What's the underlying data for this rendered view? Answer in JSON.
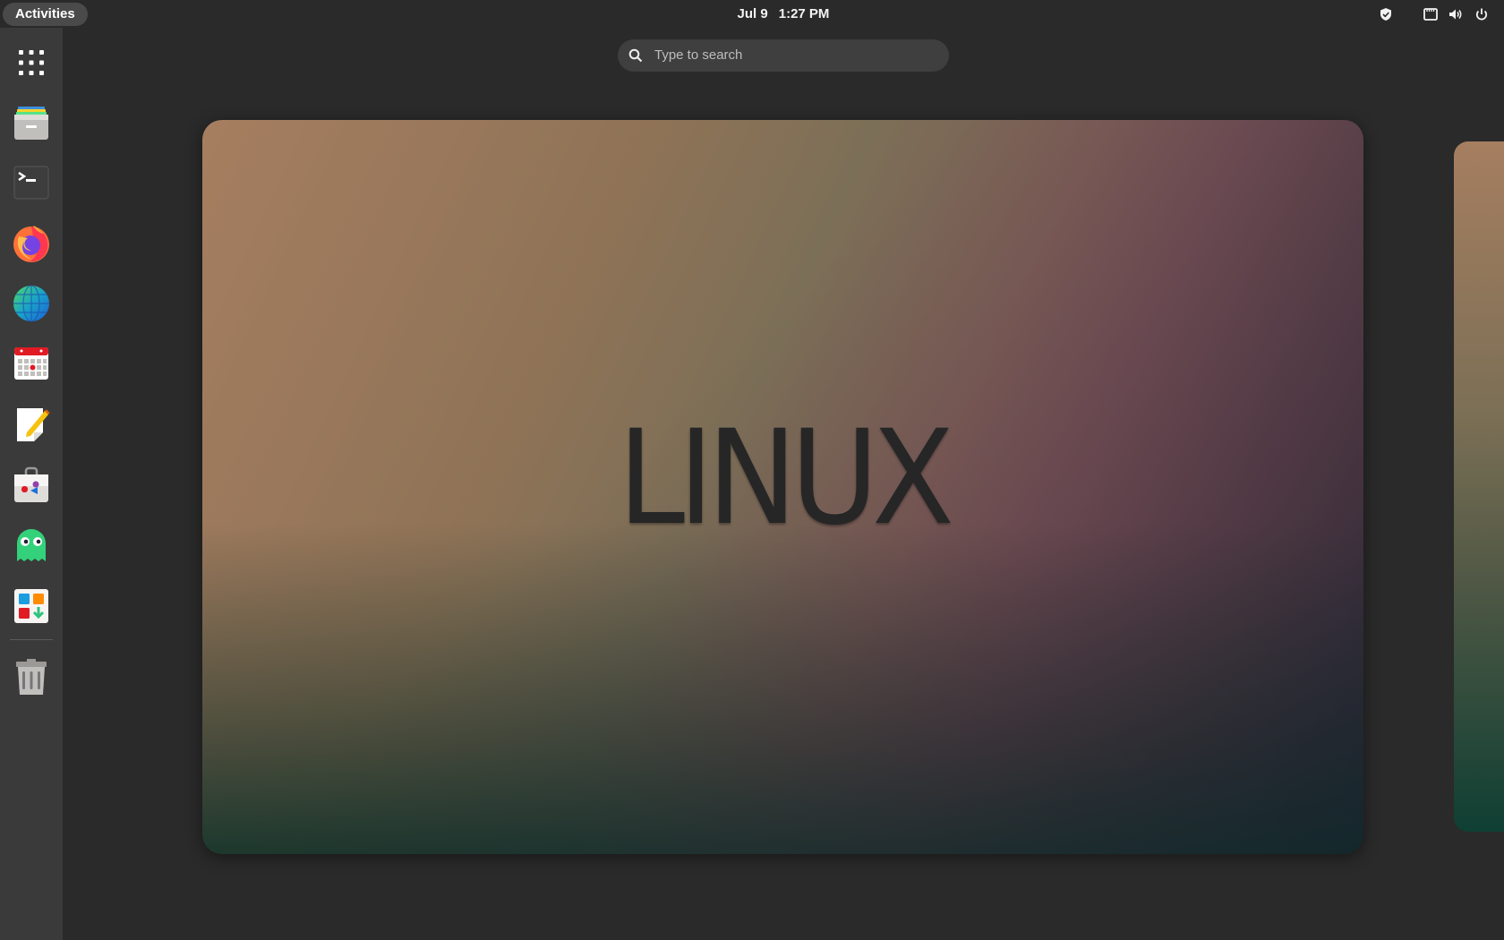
{
  "topbar": {
    "activities_label": "Activities",
    "date": "Jul 9",
    "time": "1:27 PM",
    "tray_icons": [
      "shield-icon",
      "network-icon",
      "volume-icon",
      "power-icon"
    ]
  },
  "search": {
    "placeholder": "Type to search",
    "icon": "search-icon"
  },
  "dock": {
    "items": [
      {
        "name": "show-apps",
        "icon": "app-grid-icon"
      },
      {
        "name": "files",
        "icon": "file-cabinet-icon"
      },
      {
        "name": "terminal",
        "icon": "terminal-icon"
      },
      {
        "name": "firefox",
        "icon": "firefox-icon"
      },
      {
        "name": "web-browser",
        "icon": "globe-icon"
      },
      {
        "name": "calendar",
        "icon": "calendar-icon"
      },
      {
        "name": "text-editor",
        "icon": "text-editor-icon"
      },
      {
        "name": "software",
        "icon": "software-store-icon"
      },
      {
        "name": "ghost-app",
        "icon": "ghost-icon"
      },
      {
        "name": "software-install",
        "icon": "app-install-icon"
      },
      {
        "name": "trash",
        "icon": "trash-icon"
      }
    ]
  },
  "workspace": {
    "wallpaper_text": "LINUX"
  },
  "colors": {
    "panel_bg": "#2a2a2a",
    "dock_bg": "#3a3a3a",
    "search_bg": "#3f3f3f"
  }
}
